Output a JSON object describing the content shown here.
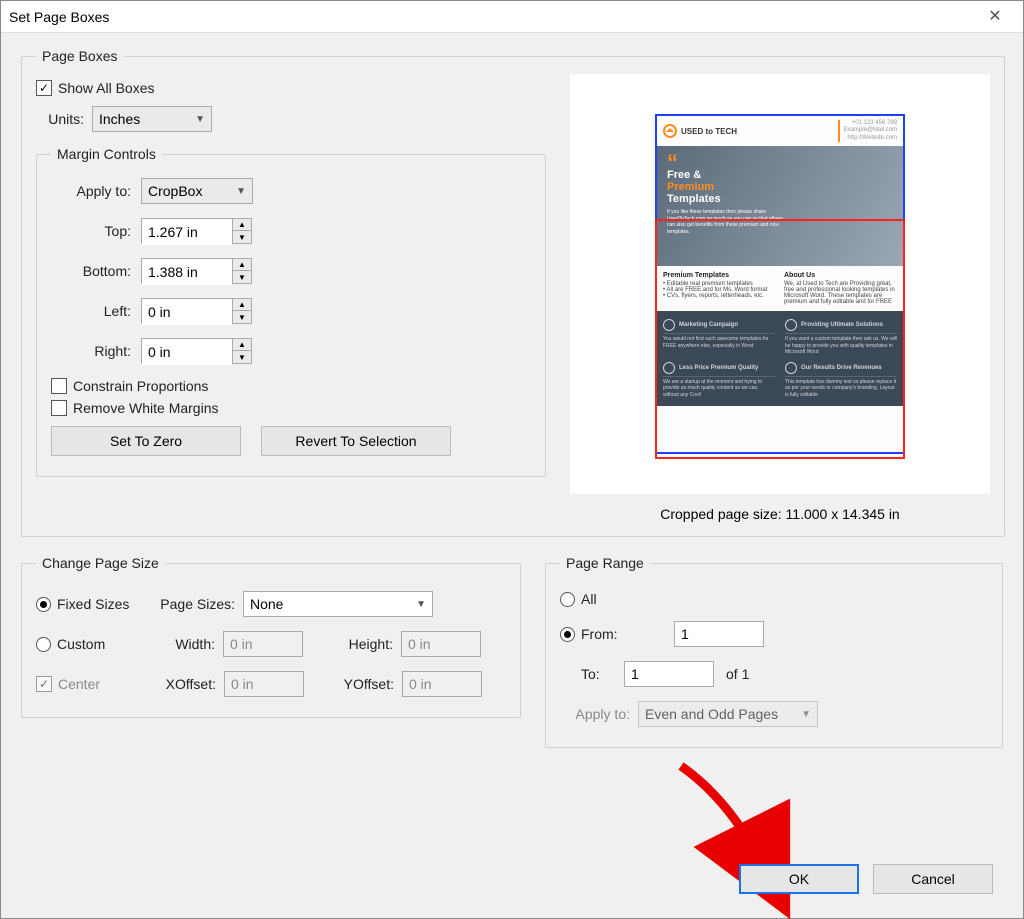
{
  "window": {
    "title": "Set Page Boxes",
    "close": "✕"
  },
  "pageBoxes": {
    "legend": "Page Boxes",
    "showAll": {
      "label": "Show All Boxes",
      "checked": true
    },
    "units": {
      "label": "Units:",
      "value": "Inches"
    },
    "marginControls": {
      "legend": "Margin Controls",
      "applyTo": {
        "label": "Apply to:",
        "value": "CropBox"
      },
      "top": {
        "label": "Top:",
        "value": "1.267 in"
      },
      "bottom": {
        "label": "Bottom:",
        "value": "1.388 in"
      },
      "left": {
        "label": "Left:",
        "value": "0 in"
      },
      "right": {
        "label": "Right:",
        "value": "0 in"
      },
      "constrain": {
        "label": "Constrain Proportions",
        "checked": false
      },
      "removeWhite": {
        "label": "Remove White Margins",
        "checked": false
      },
      "setZero": "Set To Zero",
      "revert": "Revert To Selection"
    },
    "croppedSize": "Cropped page size: 11.000 x 14.345 in"
  },
  "changeSize": {
    "legend": "Change Page Size",
    "fixed": {
      "label": "Fixed Sizes",
      "checked": true
    },
    "custom": {
      "label": "Custom",
      "checked": false
    },
    "pageSizes": {
      "label": "Page Sizes:",
      "value": "None"
    },
    "width": {
      "label": "Width:",
      "value": "0 in"
    },
    "height": {
      "label": "Height:",
      "value": "0 in"
    },
    "center": {
      "label": "Center",
      "checked": true
    },
    "xoff": {
      "label": "XOffset:",
      "value": "0 in"
    },
    "yoff": {
      "label": "YOffset:",
      "value": "0 in"
    }
  },
  "pageRange": {
    "legend": "Page Range",
    "all": {
      "label": "All",
      "checked": false
    },
    "from": {
      "label": "From:",
      "checked": true,
      "value": "1"
    },
    "to": {
      "label": "To:",
      "value": "1",
      "ofText": "of 1"
    },
    "applyTo": {
      "label": "Apply to:",
      "value": "Even and Odd Pages"
    }
  },
  "footer": {
    "ok": "OK",
    "cancel": "Cancel"
  },
  "preview": {
    "brand": "USED to TECH",
    "hero1": "Free &",
    "hero2": "Premium",
    "hero3": "Templates",
    "midH1": "Premium Templates",
    "midH2": "About Us",
    "d1": "Marketing Campaign",
    "d2": "Providing Ultimate Solutions",
    "d3": "Less Price Premium Quality",
    "d4": "Our Results Drive Revenues"
  }
}
